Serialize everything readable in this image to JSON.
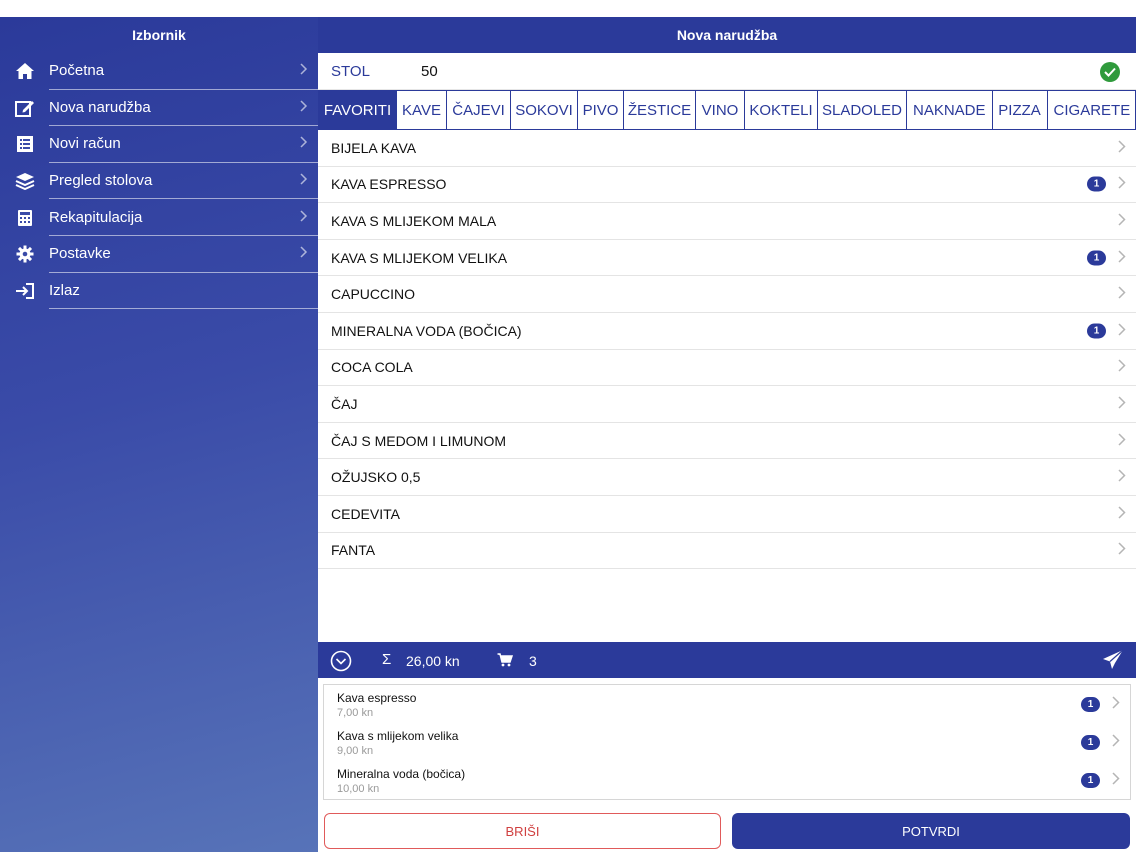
{
  "sidebar": {
    "title": "Izbornik",
    "items": [
      {
        "label": "Početna",
        "icon": "home-icon"
      },
      {
        "label": "Nova narudžba",
        "icon": "edit-icon"
      },
      {
        "label": "Novi račun",
        "icon": "receipt-icon"
      },
      {
        "label": "Pregled stolova",
        "icon": "layers-icon"
      },
      {
        "label": "Rekapitulacija",
        "icon": "calculator-icon"
      },
      {
        "label": "Postavke",
        "icon": "gear-icon"
      },
      {
        "label": "Izlaz",
        "icon": "logout-icon"
      }
    ]
  },
  "main": {
    "title": "Nova narudžba",
    "table": {
      "label": "STOL",
      "value": "50"
    },
    "tabs": [
      "FAVORITI",
      "KAVE",
      "ČAJEVI",
      "SOKOVI",
      "PIVO",
      "ŽESTICE",
      "VINO",
      "KOKTELI",
      "SLADOLED",
      "NAKNADE",
      "PIZZA",
      "CIGARETE"
    ],
    "active_tab": "FAVORITI",
    "products": [
      {
        "name": "BIJELA KAVA",
        "count": ""
      },
      {
        "name": "KAVA ESPRESSO",
        "count": "1"
      },
      {
        "name": "KAVA S MLIJEKOM MALA",
        "count": ""
      },
      {
        "name": "KAVA S MLIJEKOM VELIKA",
        "count": "1"
      },
      {
        "name": "CAPUCCINO",
        "count": ""
      },
      {
        "name": "MINERALNA VODA (BOČICA)",
        "count": "1"
      },
      {
        "name": "COCA COLA",
        "count": ""
      },
      {
        "name": "ČAJ",
        "count": ""
      },
      {
        "name": "ČAJ S MEDOM I LIMUNOM",
        "count": ""
      },
      {
        "name": "OŽUJSKO 0,5",
        "count": ""
      },
      {
        "name": "CEDEVITA",
        "count": ""
      },
      {
        "name": "FANTA",
        "count": ""
      }
    ],
    "summary": {
      "sum_symbol": "Σ",
      "total": "26,00 kn",
      "cart_count": "3"
    },
    "order_items": [
      {
        "name": "Kava espresso",
        "price": "7,00 kn",
        "count": "1"
      },
      {
        "name": "Kava s mlijekom velika",
        "price": "9,00 kn",
        "count": "1"
      },
      {
        "name": "Mineralna voda (bočica)",
        "price": "10,00 kn",
        "count": "1"
      }
    ],
    "buttons": {
      "delete": "BRIŠI",
      "confirm": "POTVRDI"
    }
  },
  "colors": {
    "primary": "#2b3a9a",
    "success": "#2f9a3c",
    "danger": "#d04040"
  }
}
